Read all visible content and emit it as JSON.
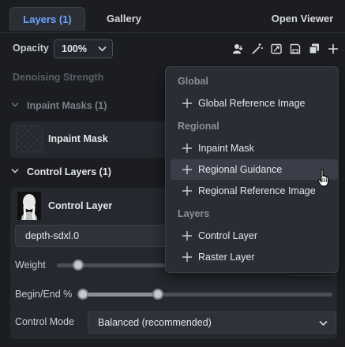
{
  "tabs": {
    "layers": "Layers (1)",
    "gallery": "Gallery",
    "open_viewer": "Open Viewer"
  },
  "toolbar": {
    "opacity_label": "Opacity",
    "opacity_value": "100%"
  },
  "denoising_label": "Denoising Strength",
  "inpaint_masks": {
    "header": "Inpaint Masks (1)",
    "item_title": "Inpaint Mask"
  },
  "control_layers": {
    "header": "Control Layers (1)",
    "item_title": "Control Layer",
    "model": "depth-sdxl.0",
    "weight_label": "Weight",
    "weight_value": 0.15,
    "begin_end_label": "Begin/End %",
    "begin_value": 0,
    "end_value": 0.3,
    "control_mode_label": "Control Mode",
    "control_mode_value": "Balanced (recommended)"
  },
  "menu": {
    "groups": [
      {
        "label": "Global",
        "items": [
          "Global Reference Image"
        ]
      },
      {
        "label": "Regional",
        "items": [
          "Inpaint Mask",
          "Regional Guidance",
          "Regional Reference Image"
        ]
      },
      {
        "label": "Layers",
        "items": [
          "Control Layer",
          "Raster Layer"
        ]
      }
    ],
    "highlighted": "Regional Guidance"
  },
  "colors": {
    "accent": "#6aa5ff",
    "background": "#1b1d21",
    "menu_bg": "#2a2d33"
  }
}
